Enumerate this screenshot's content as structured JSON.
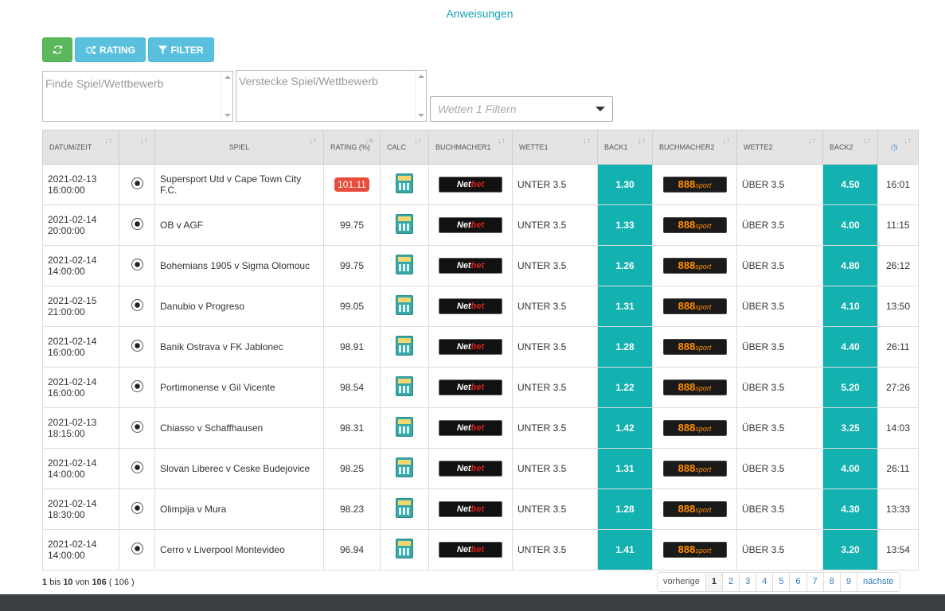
{
  "header": {
    "instructions_link": "Anweisungen"
  },
  "toolbar": {
    "rating_label": "RATING",
    "filter_label": "FILTER"
  },
  "filters": {
    "find_placeholder": "Finde Spiel/Wettbewerb",
    "hide_placeholder": "Verstecke Spiel/Wettbewerb",
    "bet_filter_placeholder": "Wetten 1 Filtern"
  },
  "table": {
    "columns": [
      "DATUM/ZEIT",
      "",
      "SPIEL",
      "RATING (%)",
      "CALC",
      "BUCHMACHER1",
      "WETTE1",
      "BACK1",
      "BUCHMACHER2",
      "WETTE2",
      "BACK2",
      ""
    ],
    "rows": [
      {
        "date": "2021-02-13",
        "time": "16:00:00",
        "match": "Supersport Utd v Cape Town City F.C.",
        "rating": "101.11",
        "highlight": true,
        "bet1": "UNTER 3.5",
        "back1": "1.30",
        "bet2": "ÜBER 3.5",
        "back2": "4.50",
        "clock": "16:01"
      },
      {
        "date": "2021-02-14",
        "time": "20:00:00",
        "match": "OB v AGF",
        "rating": "99.75",
        "highlight": false,
        "bet1": "UNTER 3.5",
        "back1": "1.33",
        "bet2": "ÜBER 3.5",
        "back2": "4.00",
        "clock": "11:15"
      },
      {
        "date": "2021-02-14",
        "time": "14:00:00",
        "match": "Bohemians 1905 v Sigma Olomouc",
        "rating": "99.75",
        "highlight": false,
        "bet1": "UNTER 3.5",
        "back1": "1.26",
        "bet2": "ÜBER 3.5",
        "back2": "4.80",
        "clock": "26:12"
      },
      {
        "date": "2021-02-15",
        "time": "21:00:00",
        "match": "Danubio v Progreso",
        "rating": "99.05",
        "highlight": false,
        "bet1": "UNTER 3.5",
        "back1": "1.31",
        "bet2": "ÜBER 3.5",
        "back2": "4.10",
        "clock": "13:50"
      },
      {
        "date": "2021-02-14",
        "time": "16:00:00",
        "match": "Banik Ostrava v FK Jablonec",
        "rating": "98.91",
        "highlight": false,
        "bet1": "UNTER 3.5",
        "back1": "1.28",
        "bet2": "ÜBER 3.5",
        "back2": "4.40",
        "clock": "26:11"
      },
      {
        "date": "2021-02-14",
        "time": "16:00:00",
        "match": "Portimonense v Gil Vicente",
        "rating": "98.54",
        "highlight": false,
        "bet1": "UNTER 3.5",
        "back1": "1.22",
        "bet2": "ÜBER 3.5",
        "back2": "5.20",
        "clock": "27:26"
      },
      {
        "date": "2021-02-13",
        "time": "18:15:00",
        "match": "Chiasso v Schaffhausen",
        "rating": "98.31",
        "highlight": false,
        "bet1": "UNTER 3.5",
        "back1": "1.42",
        "bet2": "ÜBER 3.5",
        "back2": "3.25",
        "clock": "14:03"
      },
      {
        "date": "2021-02-14",
        "time": "14:00:00",
        "match": "Slovan Liberec v Ceske Budejovice",
        "rating": "98.25",
        "highlight": false,
        "bet1": "UNTER 3.5",
        "back1": "1.31",
        "bet2": "ÜBER 3.5",
        "back2": "4.00",
        "clock": "26:11"
      },
      {
        "date": "2021-02-14",
        "time": "18:30:00",
        "match": "Olimpija v Mura",
        "rating": "98.23",
        "highlight": false,
        "bet1": "UNTER 3.5",
        "back1": "1.28",
        "bet2": "ÜBER 3.5",
        "back2": "4.30",
        "clock": "13:33"
      },
      {
        "date": "2021-02-14",
        "time": "14:00:00",
        "match": "Cerro v Liverpool Montevideo",
        "rating": "96.94",
        "highlight": false,
        "bet1": "UNTER 3.5",
        "back1": "1.41",
        "bet2": "ÜBER 3.5",
        "back2": "3.20",
        "clock": "13:54"
      }
    ]
  },
  "bookmakers": {
    "book1": {
      "name_a": "Net",
      "name_b": "bet"
    },
    "book2": {
      "name_a": "888",
      "name_b": "sport"
    }
  },
  "footer": {
    "from": "1",
    "bis": "bis",
    "to": "10",
    "von": "von",
    "total": "106",
    "paren": "( 106 )"
  },
  "pagination": {
    "prev": "vorherige",
    "pages": [
      "1",
      "2",
      "3",
      "4",
      "5",
      "6",
      "7",
      "8",
      "9"
    ],
    "active": "1",
    "next": "nächste"
  },
  "colors": {
    "accent": "#17a2b8",
    "back_cell": "#14b1b1",
    "green_btn": "#5cb85c",
    "blue_btn": "#5bc0de",
    "rating_badge": "#e74c3c"
  }
}
